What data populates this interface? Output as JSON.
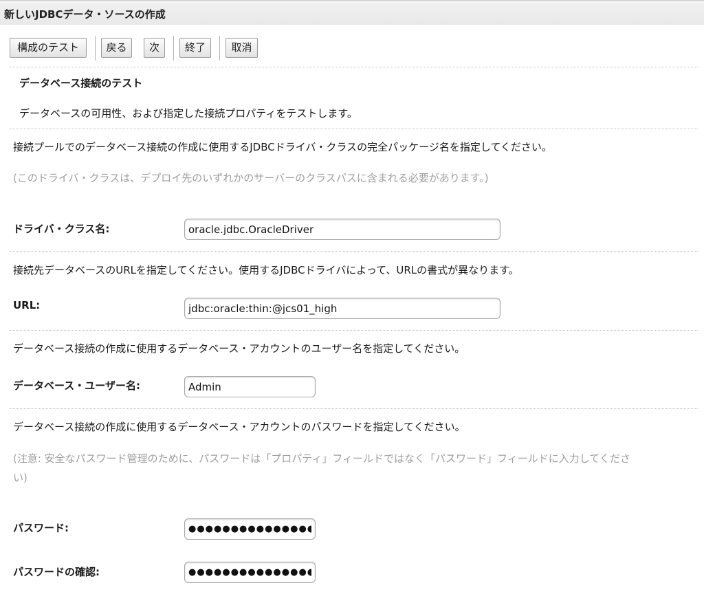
{
  "window": {
    "title": "新しいJDBCデータ・ソースの作成"
  },
  "toolbar": {
    "test_config": "構成のテスト",
    "back": "戻る",
    "next": "次",
    "finish": "終了",
    "cancel": "取消"
  },
  "section": {
    "title": "データベース接続のテスト",
    "description": "データベースの可用性、および指定した接続プロパティをテストします。"
  },
  "driver": {
    "instruction": "接続プールでのデータベース接続の作成に使用するJDBCドライバ・クラスの完全パッケージ名を指定してください。",
    "note": "(このドライバ・クラスは、デプロイ先のいずれかのサーバーのクラスパスに含まれる必要があります。)",
    "label": "ドライバ・クラス名:",
    "value": "oracle.jdbc.OracleDriver"
  },
  "url": {
    "instruction": "接続先データベースのURLを指定してください。使用するJDBCドライバによって、URLの書式が異なります。",
    "label": "URL:",
    "value": "jdbc:oracle:thin:@jcs01_high"
  },
  "user": {
    "instruction": "データベース接続の作成に使用するデータベース・アカウントのユーザー名を指定してください。",
    "label": "データベース・ユーザー名:",
    "value": "Admin"
  },
  "password": {
    "instruction": "データベース接続の作成に使用するデータベース・アカウントのパスワードを指定してください。",
    "note_line1": "(注意: 安全なパスワード管理のために、パスワードは「プロパティ」フィールドではなく「パスワード」フィールドに入力してくださ",
    "note_line2": "い)",
    "label": "パスワード:",
    "value": "●●●●●●●●●●●●●●●●●●●",
    "confirm_label": "パスワードの確認:",
    "confirm_value": "●●●●●●●●●●●●●●●●●●●"
  }
}
